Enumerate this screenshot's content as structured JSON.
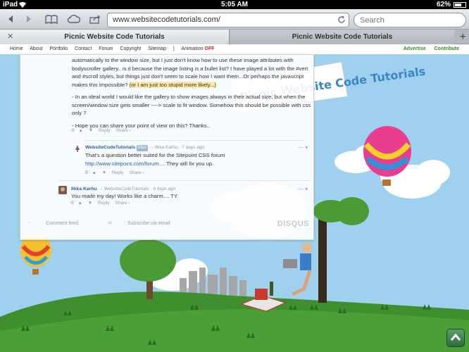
{
  "status": {
    "device": "iPad",
    "time": "5:05 AM",
    "battery": "62%"
  },
  "toolbar": {
    "url": "www.websitecodetutorials.com/",
    "search_placeholder": "Search"
  },
  "tabs": [
    {
      "label": "Picnic Website Code Tutorials"
    },
    {
      "label": "Picnic Website Code Tutorials"
    }
  ],
  "nav": {
    "items": [
      "Home",
      "About",
      "Portfolio",
      "Contact",
      "Forum",
      "Copyright",
      "Sitemap",
      "|",
      "Animation"
    ],
    "animation_state": "OFF",
    "right": [
      "Advertise",
      "Contribute"
    ]
  },
  "banner": {
    "text": "Picnic Website Code Tutorials"
  },
  "comment1": {
    "p1a": "automatically to the window size, but I just don't know how to use these image attributes with",
    "p1b": "bodyscroller gallery.. is it because the image listing is a bullet list? I have played a lot with the #vert",
    "p1c": "and #scroll styles, but things just don't seem to scale how I want them...Or perhaps the javascript",
    "p1d": "makes this impossible? ",
    "p1e": "(or I am just too stupid more likely...)",
    "p2a": "- In an ideal world I would like the gallery to show images always in their actual size, but when the",
    "p2b": "screen/window size gets smaller ----> scale to fit window. Somehow this should be possible with css",
    "p2c": "only ?",
    "p3": "- Hope you can share your point of view on this? Thanks..",
    "votes": "0",
    "reply": "Reply",
    "share": "Share ›"
  },
  "comment2": {
    "author": "WebsiteCodeTutorials",
    "badge": "Mod",
    "to": "→ Ilkka Karhu",
    "time": "7 days ago",
    "line1": "That's a question better suited for the Sitepoint CSS forum",
    "link": "http://www.sitepoint.com/forum....",
    "line2": " They will fix you up.",
    "votes": "0",
    "reply": "Reply",
    "share": "Share ›"
  },
  "comment3": {
    "author": "Ilkka Karhu",
    "to": "→ WebsiteCodeTutorials",
    "time": "8 days ago",
    "text": "You made my day! Works like a charm.... TY",
    "votes": "0",
    "reply": "Reply",
    "share": "Share ›"
  },
  "footer": {
    "comment_feed": "Comment feed",
    "subscribe": "Subscribe via email",
    "brand": "DISQUS"
  }
}
